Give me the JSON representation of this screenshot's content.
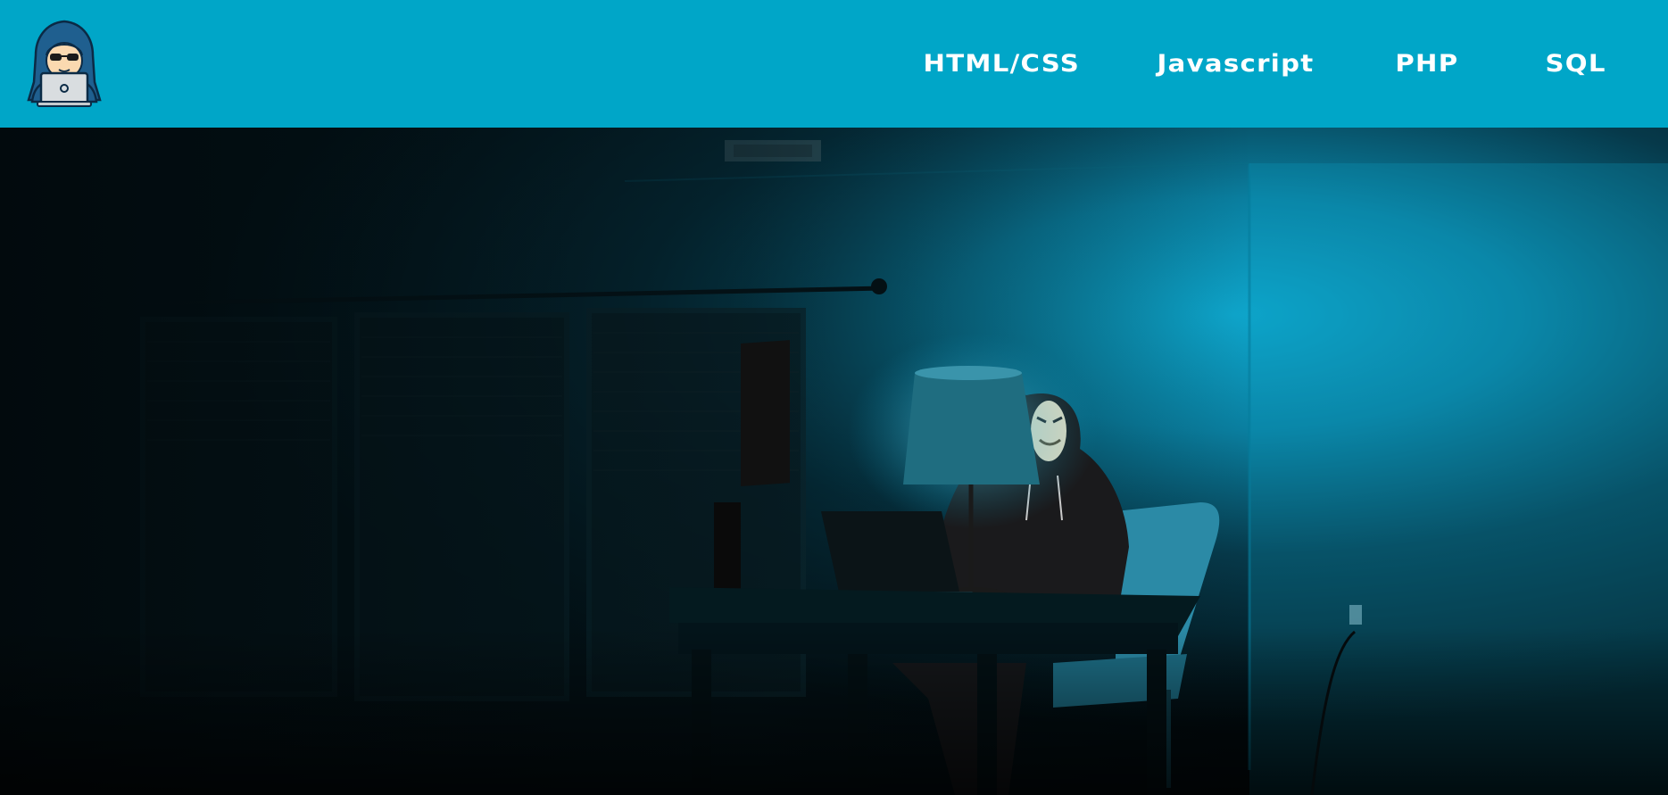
{
  "navbar": {
    "logo_icon": "hooded-hacker-with-laptop-icon",
    "background_color": "#00a6c8",
    "links": [
      "HTML/CSS",
      "Javascript",
      "PHP",
      "SQL"
    ]
  },
  "hero": {
    "image": "hooded-person-with-mask-at-desk-in-dark-blue-room",
    "accent_color": "#0a9cc0"
  }
}
